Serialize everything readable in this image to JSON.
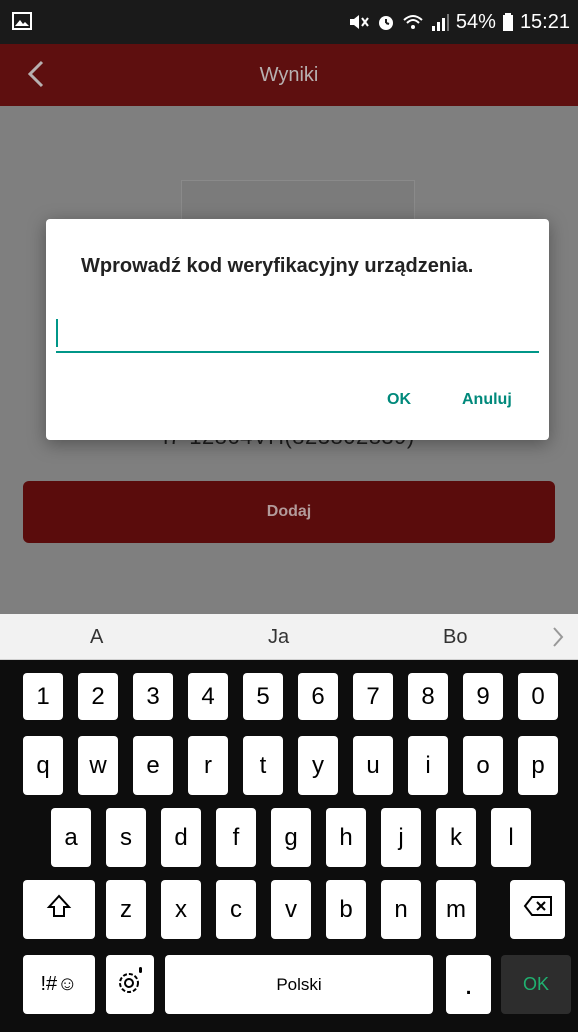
{
  "status_bar": {
    "battery": "54%",
    "time": "15:21"
  },
  "app_bar": {
    "title": "Wyniki"
  },
  "content": {
    "device_text": "i7-12864VH(823802839)",
    "add_button": "Dodaj"
  },
  "dialog": {
    "title": "Wprowadź kod weryfikacyjny urządzenia.",
    "input_value": "",
    "ok_label": "OK",
    "cancel_label": "Anuluj"
  },
  "suggestions": [
    "A",
    "Ja",
    "Bo"
  ],
  "keyboard": {
    "row_numbers": [
      "1",
      "2",
      "3",
      "4",
      "5",
      "6",
      "7",
      "8",
      "9",
      "0"
    ],
    "row_top": [
      "q",
      "w",
      "e",
      "r",
      "t",
      "y",
      "u",
      "i",
      "o",
      "p"
    ],
    "row_middle": [
      "a",
      "s",
      "d",
      "f",
      "g",
      "h",
      "j",
      "k",
      "l"
    ],
    "row_bottom": [
      "z",
      "x",
      "c",
      "v",
      "b",
      "n",
      "m"
    ],
    "symbols_label": "!#☺",
    "space_label": "Polski",
    "period_label": ".",
    "ok_label": "OK"
  },
  "colors": {
    "app_bar": "#5e0f0f",
    "accent": "#009688",
    "button_dark_red": "#5a0c0c"
  }
}
